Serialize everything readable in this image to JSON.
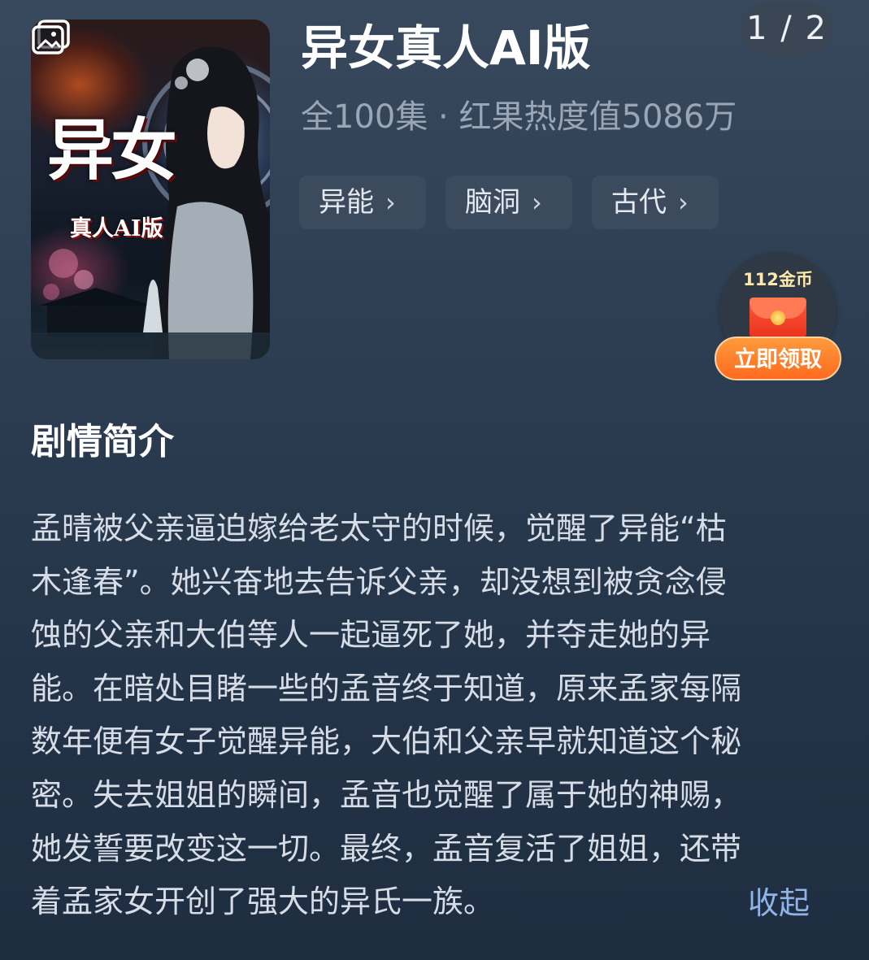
{
  "page_counter": "1 / 2",
  "cover": {
    "title_art": "异女",
    "subtitle_art": "真人AI版",
    "gallery_icon": "gallery-icon"
  },
  "drama": {
    "title": "异女真人AI版",
    "meta": "全100集 · 红果热度值5086万",
    "tags": [
      {
        "label": "异能",
        "icon": "chevron-right-icon"
      },
      {
        "label": "脑洞",
        "icon": "chevron-right-icon"
      },
      {
        "label": "古代",
        "icon": "chevron-right-icon"
      }
    ]
  },
  "reward": {
    "coins_label": "112金币",
    "icon": "red-envelope-icon",
    "button_label": "立即领取"
  },
  "synopsis": {
    "heading": "剧情简介",
    "lines": [
      "孟晴被父亲逼迫嫁给老太守的时候，觉醒了异能“枯",
      "木逢春”。她兴奋地去告诉父亲，却没想到被贪念侵",
      "蚀的父亲和大伯等人一起逼死了她，并夺走她的异",
      "能。在暗处目睹一些的孟音终于知道，原来孟家每隔",
      "数年便有女子觉醒异能，大伯和父亲早就知道这个秘",
      "密。失去姐姐的瞬间，孟音也觉醒了属于她的神赐，",
      "她发誓要改变这一切。最终，孟音复活了姐姐，还带",
      "着孟家女开创了强大的异氏一族。"
    ],
    "collapse_label": "收起"
  },
  "colors": {
    "background_top": "#38485d",
    "background_bottom": "#1e2d40",
    "tag_bg": "#3c4a5d",
    "link": "#8fb4e8",
    "claim_button": "#ff7a2a"
  }
}
